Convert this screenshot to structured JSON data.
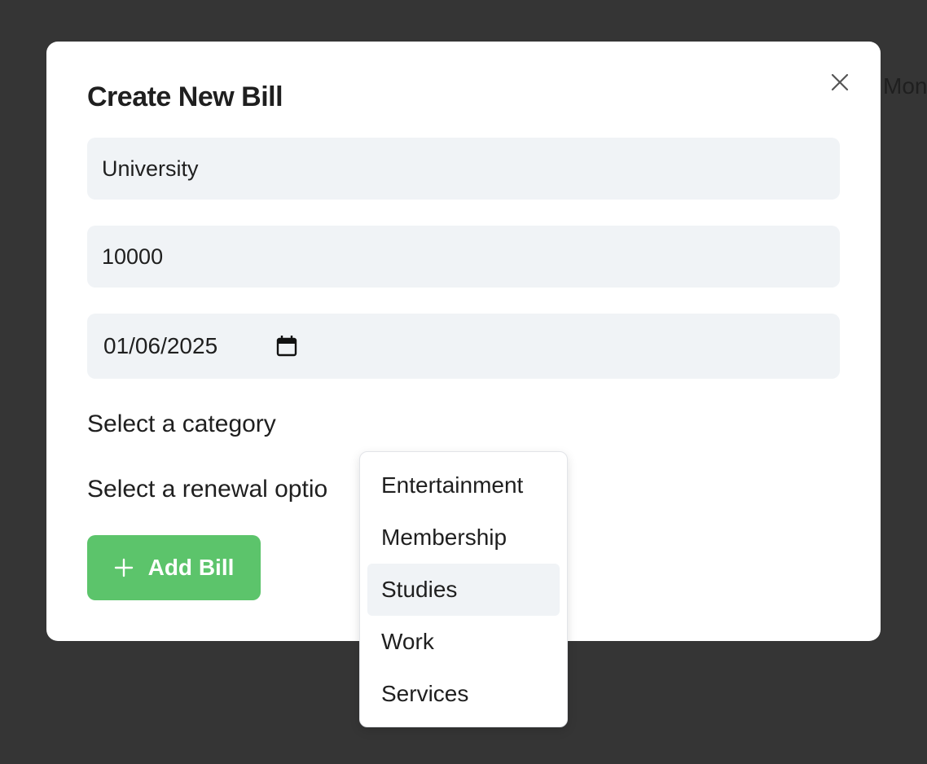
{
  "background": {
    "partial_text": "Mon"
  },
  "modal": {
    "title": "Create New Bill",
    "fields": {
      "name_value": "University",
      "amount_value": "10000",
      "date_value": "01/06/2025"
    },
    "category_placeholder": "Select a category",
    "renewal_placeholder": "Select a renewal optio",
    "add_button_label": "Add Bill",
    "close_icon": "close-icon",
    "add_icon": "plus-icon",
    "calendar_icon": "calendar-icon"
  },
  "dropdown": {
    "options": [
      "Entertainment",
      "Membership",
      "Studies",
      "Work",
      "Services"
    ],
    "highlighted": "Studies"
  },
  "colors": {
    "overlay": "#353535",
    "modal_bg": "#ffffff",
    "input_bg": "#f0f3f6",
    "primary_button": "#5cc46b",
    "text": "#1f1f1f"
  }
}
